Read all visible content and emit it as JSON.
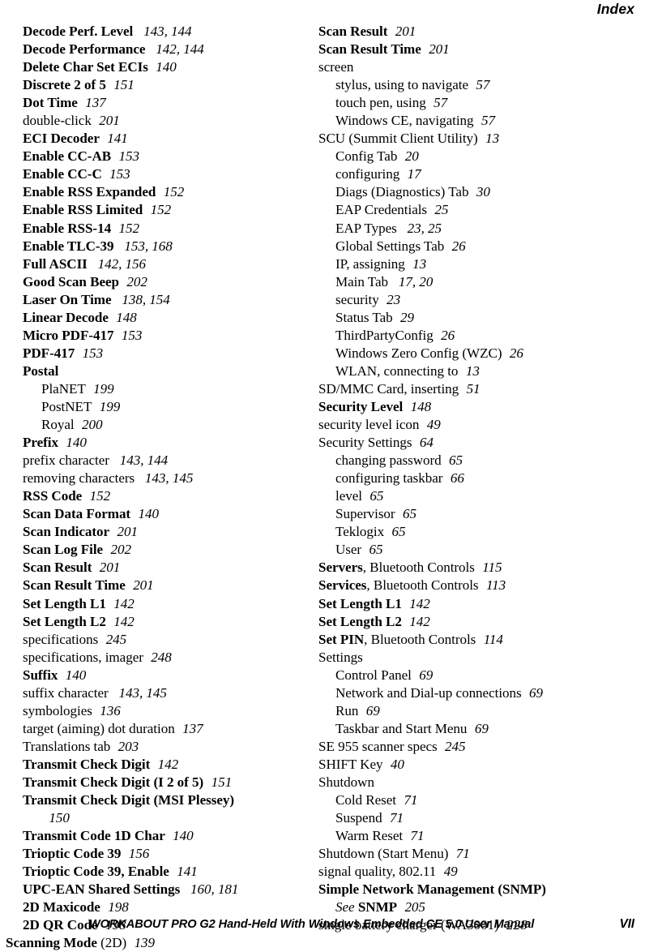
{
  "running_head": "Index",
  "footer": {
    "title": "WORKABOUT PRO G2 Hand-Held With Windows Embedded CE 5.0 User Manual",
    "page_number": "VII"
  },
  "columns": {
    "left": [
      {
        "level": 1,
        "bold": true,
        "term": "Decode Perf. Level",
        "tail": "",
        "pages": "143, 144"
      },
      {
        "level": 1,
        "bold": true,
        "term": "Decode Performance",
        "tail": "",
        "pages": "142, 144"
      },
      {
        "level": 1,
        "bold": true,
        "term": "Delete Char Set ECIs",
        "tail": "",
        "pages": "140"
      },
      {
        "level": 1,
        "bold": true,
        "term": "Discrete 2 of 5",
        "tail": "",
        "pages": "151"
      },
      {
        "level": 1,
        "bold": true,
        "term": "Dot Time",
        "tail": "",
        "pages": "137"
      },
      {
        "level": 1,
        "bold": false,
        "term": "double-click",
        "tail": "",
        "pages": "201"
      },
      {
        "level": 1,
        "bold": true,
        "term": "ECI Decoder",
        "tail": "",
        "pages": "141"
      },
      {
        "level": 1,
        "bold": true,
        "term": "Enable CC-AB",
        "tail": "",
        "pages": "153"
      },
      {
        "level": 1,
        "bold": true,
        "term": "Enable CC-C",
        "tail": "",
        "pages": "153"
      },
      {
        "level": 1,
        "bold": true,
        "term": "Enable RSS Expanded",
        "tail": "",
        "pages": "152"
      },
      {
        "level": 1,
        "bold": true,
        "term": "Enable RSS Limited",
        "tail": "",
        "pages": "152"
      },
      {
        "level": 1,
        "bold": true,
        "term": "Enable RSS-14",
        "tail": "",
        "pages": "152"
      },
      {
        "level": 1,
        "bold": true,
        "term": "Enable TLC-39",
        "tail": "",
        "pages": "153, 168"
      },
      {
        "level": 1,
        "bold": true,
        "term": "Full ASCII",
        "tail": "",
        "pages": "142, 156"
      },
      {
        "level": 1,
        "bold": true,
        "term": "Good Scan Beep",
        "tail": "",
        "pages": "202"
      },
      {
        "level": 1,
        "bold": true,
        "term": "Laser On Time",
        "tail": "",
        "pages": "138, 154"
      },
      {
        "level": 1,
        "bold": true,
        "term": "Linear Decode",
        "tail": "",
        "pages": "148"
      },
      {
        "level": 1,
        "bold": true,
        "term": "Micro PDF-417",
        "tail": "",
        "pages": "153"
      },
      {
        "level": 1,
        "bold": true,
        "term": "PDF-417",
        "tail": "",
        "pages": "153"
      },
      {
        "level": 1,
        "bold": true,
        "term": "Postal",
        "tail": "",
        "pages": ""
      },
      {
        "level": 2,
        "bold": false,
        "term": "PlaNET",
        "tail": "",
        "pages": "199"
      },
      {
        "level": 2,
        "bold": false,
        "term": "PostNET",
        "tail": "",
        "pages": "199"
      },
      {
        "level": 2,
        "bold": false,
        "term": "Royal",
        "tail": "",
        "pages": "200"
      },
      {
        "level": 1,
        "bold": true,
        "term": "Prefix",
        "tail": "",
        "pages": "140"
      },
      {
        "level": 1,
        "bold": false,
        "term": "prefix character",
        "tail": "",
        "pages": "143, 144"
      },
      {
        "level": 1,
        "bold": false,
        "term": "removing characters",
        "tail": "",
        "pages": "143, 145"
      },
      {
        "level": 1,
        "bold": true,
        "term": "RSS Code",
        "tail": "",
        "pages": "152"
      },
      {
        "level": 1,
        "bold": true,
        "term": "Scan Data Format",
        "tail": "",
        "pages": "140"
      },
      {
        "level": 1,
        "bold": true,
        "term": "Scan Indicator",
        "tail": "",
        "pages": "201"
      },
      {
        "level": 1,
        "bold": true,
        "term": "Scan Log File",
        "tail": "",
        "pages": "202"
      },
      {
        "level": 1,
        "bold": true,
        "term": "Scan Result",
        "tail": "",
        "pages": "201"
      },
      {
        "level": 1,
        "bold": true,
        "term": "Scan Result Time",
        "tail": "",
        "pages": "201"
      },
      {
        "level": 1,
        "bold": true,
        "term": "Set Length L1",
        "tail": "",
        "pages": "142"
      },
      {
        "level": 1,
        "bold": true,
        "term": "Set Length L2",
        "tail": "",
        "pages": "142"
      },
      {
        "level": 1,
        "bold": false,
        "term": "specifications",
        "tail": "",
        "pages": "245"
      },
      {
        "level": 1,
        "bold": false,
        "term": "specifications, imager",
        "tail": "",
        "pages": "248"
      },
      {
        "level": 1,
        "bold": true,
        "term": "Suffix",
        "tail": "",
        "pages": "140"
      },
      {
        "level": 1,
        "bold": false,
        "term": "suffix character",
        "tail": "",
        "pages": "143, 145"
      },
      {
        "level": 1,
        "bold": false,
        "term": "symbologies",
        "tail": "",
        "pages": "136"
      },
      {
        "level": 1,
        "bold": false,
        "term": "target (aiming) dot duration",
        "tail": "",
        "pages": "137"
      },
      {
        "level": 1,
        "bold": false,
        "term": "Translations tab",
        "tail": "",
        "pages": "203"
      },
      {
        "level": 1,
        "bold": true,
        "term": "Transmit Check Digit",
        "tail": "",
        "pages": "142"
      },
      {
        "level": 1,
        "bold": true,
        "term": "Transmit Check Digit (I 2 of 5)",
        "tail": "",
        "pages": "151"
      },
      {
        "level": 1,
        "bold": true,
        "term": "Transmit Check Digit (MSI Plessey)",
        "tail": "",
        "pages": ""
      },
      {
        "level": 2,
        "bold": false,
        "term": "",
        "tail": "",
        "pages": "150"
      },
      {
        "level": 1,
        "bold": true,
        "term": "Transmit Code 1D Char",
        "tail": "",
        "pages": "140"
      },
      {
        "level": 1,
        "bold": true,
        "term": "Trioptic Code 39",
        "tail": "",
        "pages": "156"
      },
      {
        "level": 1,
        "bold": true,
        "term": "Trioptic Code 39, Enable",
        "tail": "",
        "pages": "141"
      },
      {
        "level": 1,
        "bold": true,
        "term": "UPC-EAN Shared Settings",
        "tail": "",
        "pages": "160, 181"
      },
      {
        "level": 1,
        "bold": true,
        "term": "2D Maxicode",
        "tail": "",
        "pages": "198"
      },
      {
        "level": 1,
        "bold": true,
        "term": "2D QR Code",
        "tail": "",
        "pages": "198"
      },
      {
        "level": 0,
        "bold": true,
        "term": "Scanning Mode",
        "tail": " (2D)",
        "pages": "139"
      }
    ],
    "right": [
      {
        "level": 0,
        "bold": true,
        "term": "Scan Result",
        "tail": "",
        "pages": "201"
      },
      {
        "level": 0,
        "bold": true,
        "term": "Scan Result Time",
        "tail": "",
        "pages": "201"
      },
      {
        "level": 0,
        "bold": false,
        "term": "screen",
        "tail": "",
        "pages": ""
      },
      {
        "level": 1,
        "bold": false,
        "term": "stylus, using to navigate",
        "tail": "",
        "pages": "57"
      },
      {
        "level": 1,
        "bold": false,
        "term": "touch pen, using",
        "tail": "",
        "pages": "57"
      },
      {
        "level": 1,
        "bold": false,
        "term": "Windows CE, navigating",
        "tail": "",
        "pages": "57"
      },
      {
        "level": 0,
        "bold": false,
        "term": "SCU (Summit Client Utility)",
        "tail": "",
        "pages": "13"
      },
      {
        "level": 1,
        "bold": false,
        "term": "Config Tab",
        "tail": "",
        "pages": "20"
      },
      {
        "level": 1,
        "bold": false,
        "term": "configuring",
        "tail": "",
        "pages": "17"
      },
      {
        "level": 1,
        "bold": false,
        "term": "Diags (Diagnostics) Tab",
        "tail": "",
        "pages": "30"
      },
      {
        "level": 1,
        "bold": false,
        "term": "EAP Credentials",
        "tail": "",
        "pages": "25"
      },
      {
        "level": 1,
        "bold": false,
        "term": "EAP Types",
        "tail": "",
        "pages": "23, 25"
      },
      {
        "level": 1,
        "bold": false,
        "term": "Global Settings Tab",
        "tail": "",
        "pages": "26"
      },
      {
        "level": 1,
        "bold": false,
        "term": "IP, assigning",
        "tail": "",
        "pages": "13"
      },
      {
        "level": 1,
        "bold": false,
        "term": "Main Tab",
        "tail": "",
        "pages": "17, 20"
      },
      {
        "level": 1,
        "bold": false,
        "term": "security",
        "tail": "",
        "pages": "23"
      },
      {
        "level": 1,
        "bold": false,
        "term": "Status Tab",
        "tail": "",
        "pages": "29"
      },
      {
        "level": 1,
        "bold": false,
        "term": "ThirdPartyConfig",
        "tail": "",
        "pages": "26"
      },
      {
        "level": 1,
        "bold": false,
        "term": "Windows Zero Config (WZC)",
        "tail": "",
        "pages": "26"
      },
      {
        "level": 1,
        "bold": false,
        "term": "WLAN, connecting to",
        "tail": "",
        "pages": "13"
      },
      {
        "level": 0,
        "bold": false,
        "term": "SD/MMC Card, inserting",
        "tail": "",
        "pages": "51"
      },
      {
        "level": 0,
        "bold": true,
        "term": "Security Level",
        "tail": "",
        "pages": "148"
      },
      {
        "level": 0,
        "bold": false,
        "term": "security level icon",
        "tail": "",
        "pages": "49"
      },
      {
        "level": 0,
        "bold": false,
        "term": "Security Settings",
        "tail": "",
        "pages": "64"
      },
      {
        "level": 1,
        "bold": false,
        "term": "changing password",
        "tail": "",
        "pages": "65"
      },
      {
        "level": 1,
        "bold": false,
        "term": "configuring taskbar",
        "tail": "",
        "pages": "66"
      },
      {
        "level": 1,
        "bold": false,
        "term": "level",
        "tail": "",
        "pages": "65"
      },
      {
        "level": 1,
        "bold": false,
        "term": "Supervisor",
        "tail": "",
        "pages": "65"
      },
      {
        "level": 1,
        "bold": false,
        "term": "Teklogix",
        "tail": "",
        "pages": "65"
      },
      {
        "level": 1,
        "bold": false,
        "term": "User",
        "tail": "",
        "pages": "65"
      },
      {
        "level": 0,
        "bold": true,
        "term": "Servers",
        "tail": ", Bluetooth Controls",
        "pages": "115"
      },
      {
        "level": 0,
        "bold": true,
        "term": "Services",
        "tail": ", Bluetooth Controls",
        "pages": "113"
      },
      {
        "level": 0,
        "bold": true,
        "term": "Set Length L1",
        "tail": "",
        "pages": "142"
      },
      {
        "level": 0,
        "bold": true,
        "term": "Set Length L2",
        "tail": "",
        "pages": "142"
      },
      {
        "level": 0,
        "bold": true,
        "term": "Set PIN",
        "tail": ", Bluetooth Controls",
        "pages": "114"
      },
      {
        "level": 0,
        "bold": false,
        "term": "Settings",
        "tail": "",
        "pages": ""
      },
      {
        "level": 1,
        "bold": false,
        "term": "Control Panel",
        "tail": "",
        "pages": "69"
      },
      {
        "level": 1,
        "bold": false,
        "term": "Network and Dial-up connections",
        "tail": "",
        "pages": "69"
      },
      {
        "level": 1,
        "bold": false,
        "term": "Run",
        "tail": "",
        "pages": "69"
      },
      {
        "level": 1,
        "bold": false,
        "term": "Taskbar and Start Menu",
        "tail": "",
        "pages": "69"
      },
      {
        "level": 0,
        "bold": false,
        "term": "SE 955 scanner specs",
        "tail": "",
        "pages": "245"
      },
      {
        "level": 0,
        "bold": false,
        "term": "SHIFT Key",
        "tail": "",
        "pages": "40"
      },
      {
        "level": 0,
        "bold": false,
        "term": "Shutdown",
        "tail": "",
        "pages": ""
      },
      {
        "level": 1,
        "bold": false,
        "term": "Cold Reset",
        "tail": "",
        "pages": "71"
      },
      {
        "level": 1,
        "bold": false,
        "term": "Suspend",
        "tail": "",
        "pages": "71"
      },
      {
        "level": 1,
        "bold": false,
        "term": "Warm Reset",
        "tail": "",
        "pages": "71"
      },
      {
        "level": 0,
        "bold": false,
        "term": "Shutdown (Start Menu)",
        "tail": "",
        "pages": "71"
      },
      {
        "level": 0,
        "bold": false,
        "term": "signal quality, 802.11",
        "tail": "",
        "pages": "49"
      },
      {
        "level": 0,
        "bold": true,
        "term": "Simple Network Management (SNMP)",
        "tail": "",
        "pages": ""
      },
      {
        "level": 1,
        "bold": true,
        "see": "See",
        "term": "SNMP",
        "tail": "",
        "pages": "205"
      },
      {
        "level": 0,
        "bold": false,
        "term": "single battery charger (WA3001)",
        "tail": "",
        "pages": "228"
      }
    ]
  }
}
